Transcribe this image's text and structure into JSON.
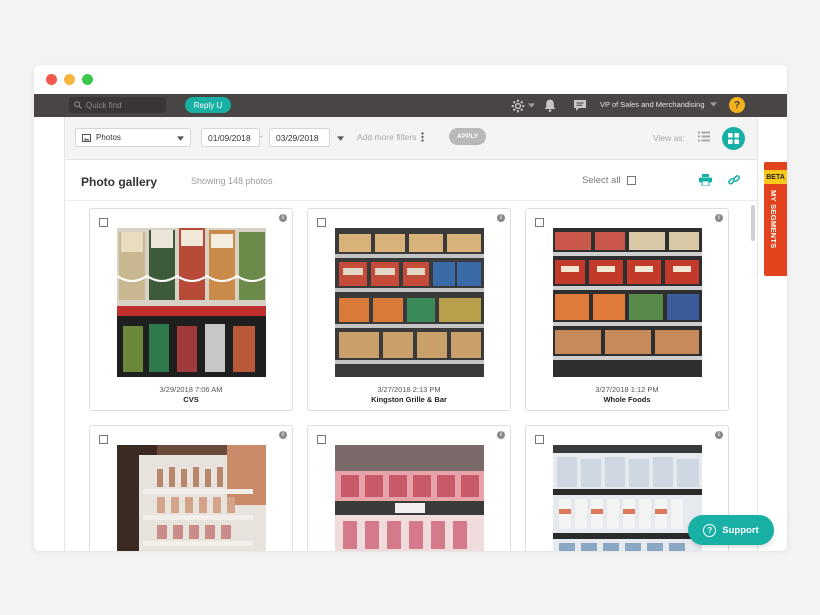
{
  "topbar": {
    "search_placeholder": "Quick find",
    "reply_label": "Reply U",
    "role_label": "VP of Sales and Merchandising",
    "help_label": "?"
  },
  "filters": {
    "type_value": "Photos",
    "date_from": "01/09/2018",
    "date_to": "03/29/2018",
    "date_separator": "-",
    "more_filters": "Add more filters",
    "apply_label": "APPLY",
    "view_as": "View as:"
  },
  "gallery": {
    "title": "Photo gallery",
    "showing": "Showing 148 photos",
    "select_all": "Select all",
    "cards": [
      {
        "timestamp": "3/29/2018 7:06 AM",
        "store": "CVS",
        "photo": "drinks-cooler-photo"
      },
      {
        "timestamp": "3/27/2018 2:13 PM",
        "store": "Kingston Grille & Bar",
        "photo": "snack-bar-shelf-photo"
      },
      {
        "timestamp": "3/27/2018 1:12 PM",
        "store": "Whole Foods",
        "photo": "clif-bar-shelf-photo"
      },
      {
        "timestamp": "",
        "store": "",
        "photo": "cosmetics-display-photo"
      },
      {
        "timestamp": "",
        "store": "",
        "photo": "benefit-cosmetics-photo"
      },
      {
        "timestamp": "",
        "store": "",
        "photo": "skincare-shelf-photo"
      }
    ]
  },
  "side_tab": {
    "badge": "BETA",
    "label": "MY SEGMENTS"
  },
  "support": {
    "label": "Support"
  },
  "colors": {
    "accent": "#18b0a5",
    "topbar": "#4a4545",
    "help": "#f3b21b",
    "beta_tab": "#e2431d"
  }
}
